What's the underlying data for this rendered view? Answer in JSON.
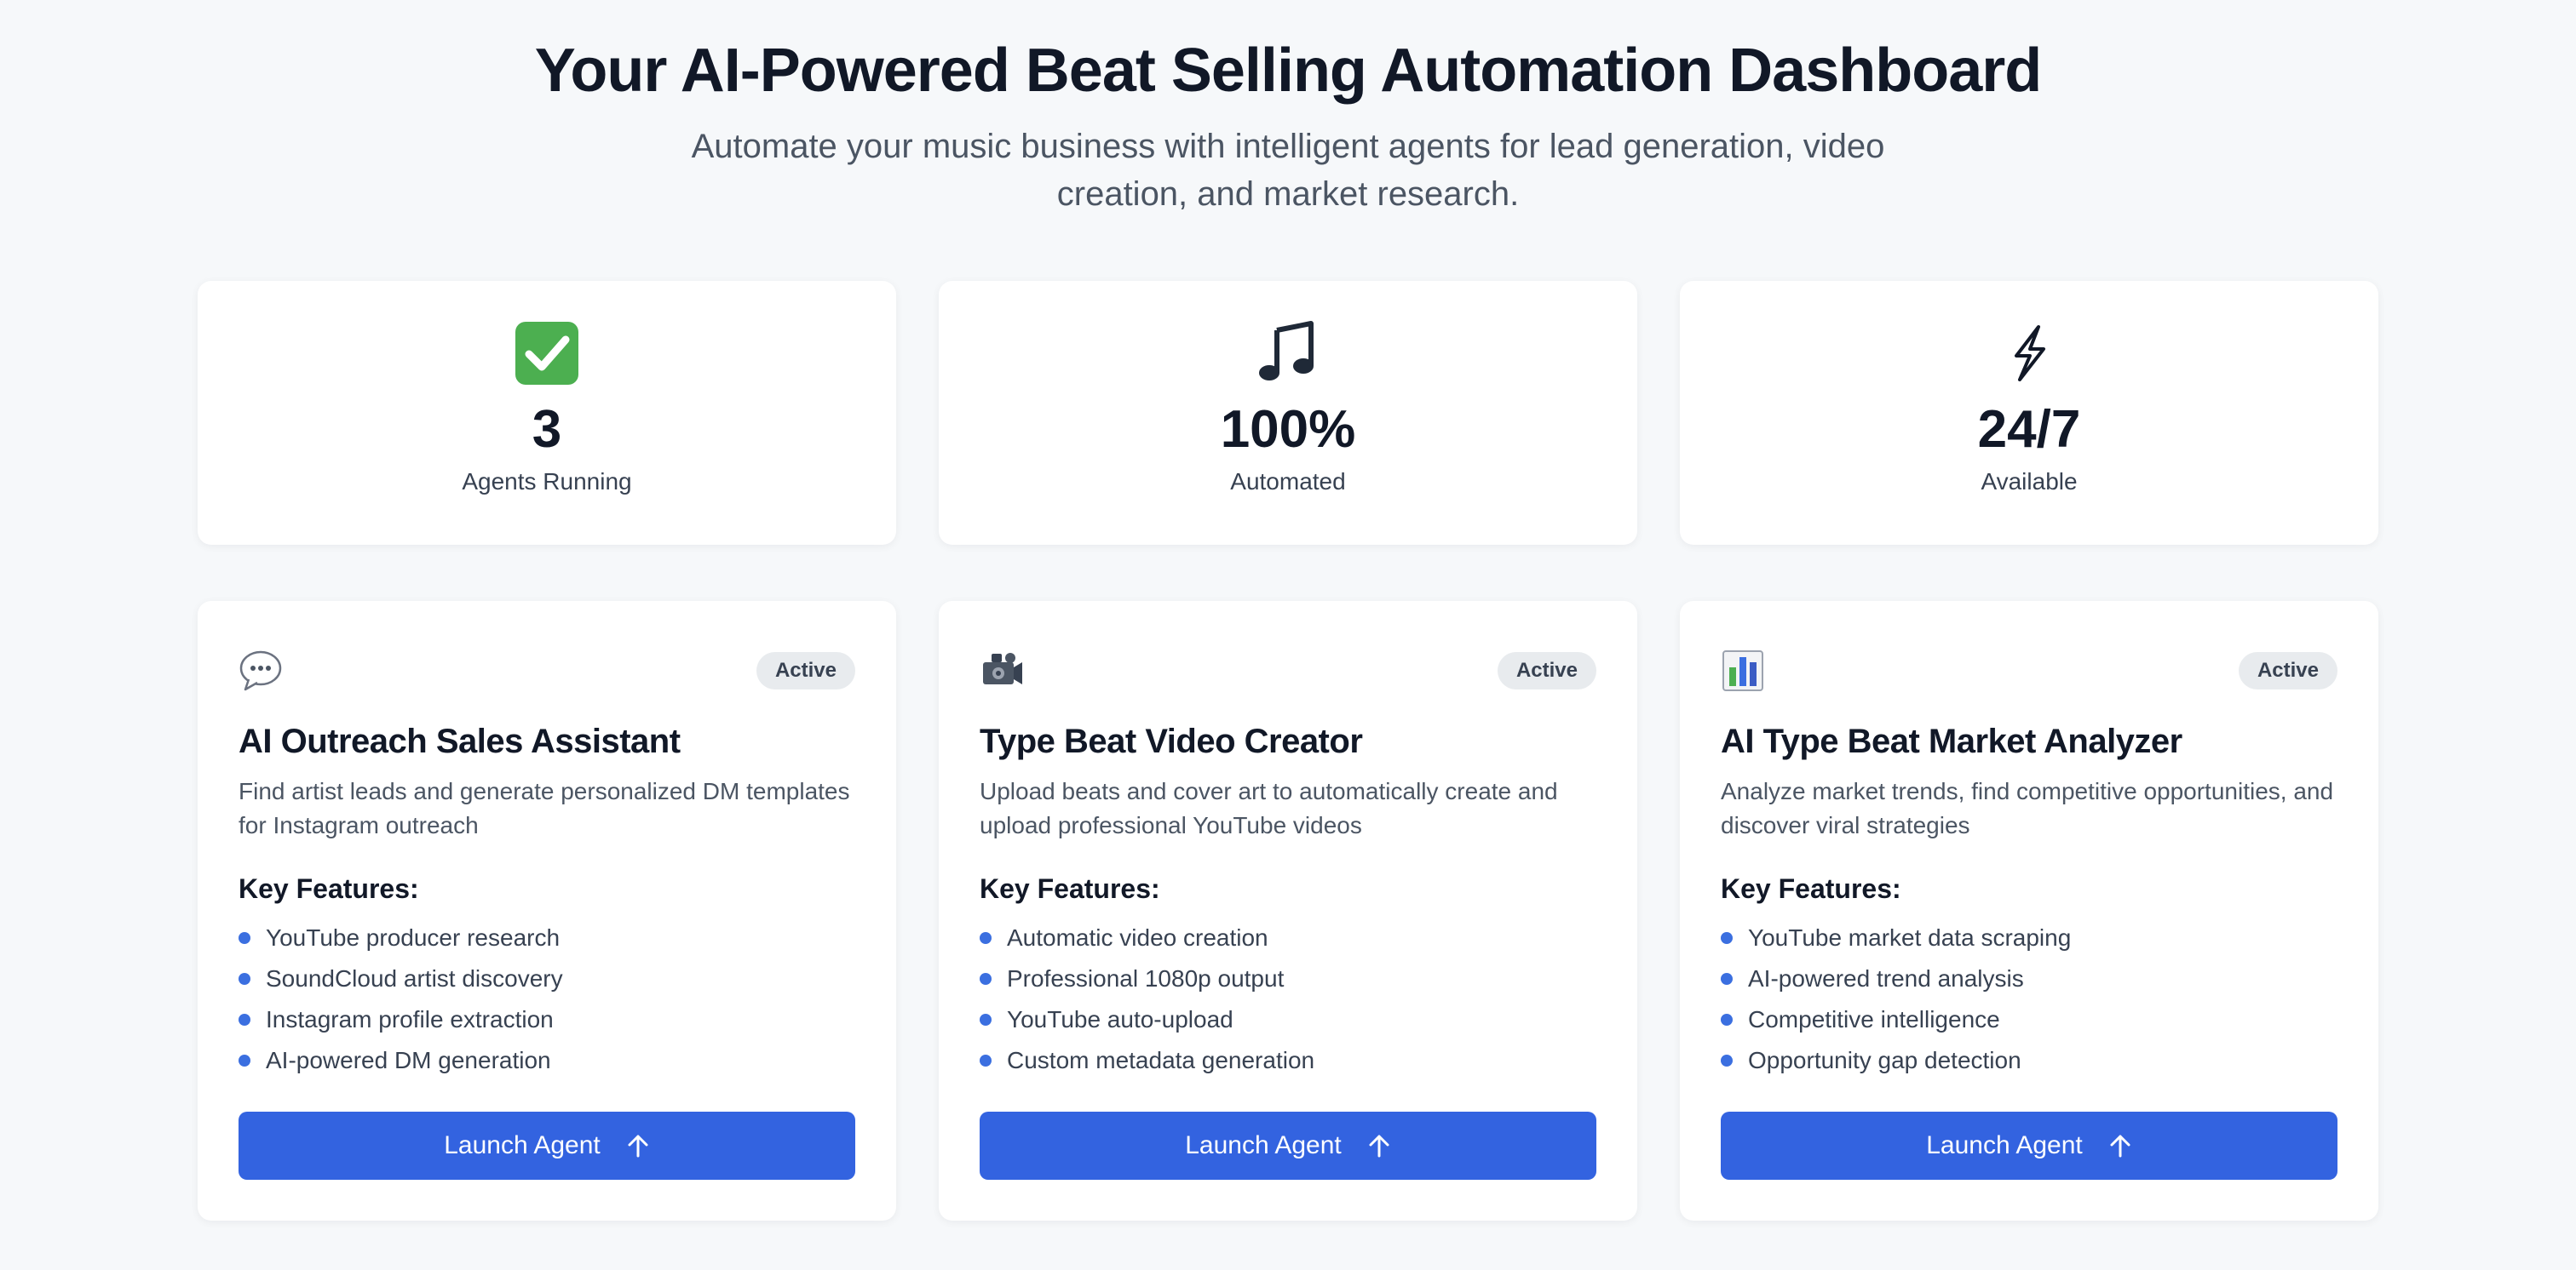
{
  "header": {
    "title": "Your AI-Powered Beat Selling Automation Dashboard",
    "subtitle": "Automate your music business with intelligent agents for lead generation, video creation, and market research."
  },
  "stats": [
    {
      "icon": "check-mark-icon",
      "value": "3",
      "label": "Agents Running"
    },
    {
      "icon": "music-note-icon",
      "value": "100%",
      "label": "Automated"
    },
    {
      "icon": "lightning-icon",
      "value": "24/7",
      "label": "Available"
    }
  ],
  "agents": [
    {
      "icon": "speech-bubble-icon",
      "badge": "Active",
      "title": "AI Outreach Sales Assistant",
      "description": "Find artist leads and generate personalized DM templates for Instagram outreach",
      "features_heading": "Key Features:",
      "features": [
        "YouTube producer research",
        "SoundCloud artist discovery",
        "Instagram profile extraction",
        "AI-powered DM generation"
      ],
      "button_label": "Launch Agent"
    },
    {
      "icon": "video-camera-icon",
      "badge": "Active",
      "title": "Type Beat Video Creator",
      "description": "Upload beats and cover art to automatically create and upload professional YouTube videos",
      "features_heading": "Key Features:",
      "features": [
        "Automatic video creation",
        "Professional 1080p output",
        "YouTube auto-upload",
        "Custom metadata generation"
      ],
      "button_label": "Launch Agent"
    },
    {
      "icon": "bar-chart-icon",
      "badge": "Active",
      "title": "AI Type Beat Market Analyzer",
      "description": "Analyze market trends, find competitive opportunities, and discover viral strategies",
      "features_heading": "Key Features:",
      "features": [
        "YouTube market data scraping",
        "AI-powered trend analysis",
        "Competitive intelligence",
        "Opportunity gap detection"
      ],
      "button_label": "Launch Agent"
    }
  ],
  "colors": {
    "background": "#f6f8fa",
    "primary_button": "#3363e0",
    "bullet": "#3b6fe0",
    "badge_bg": "#e8ebee",
    "check_green": "#4caf50"
  }
}
